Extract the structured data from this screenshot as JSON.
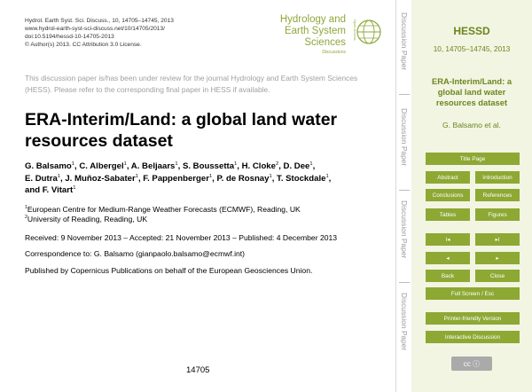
{
  "header": {
    "journal_line": "Hydrol. Earth Syst. Sci. Discuss., 10, 14705–14745, 2013",
    "url": "www.hydrol-earth-syst-sci-discuss.net/10/14705/2013/",
    "doi": "doi:10.5194/hessd-10-14705-2013",
    "license": "© Author(s) 2013. CC Attribution 3.0 License."
  },
  "logo": {
    "line1": "Hydrology and",
    "line2": "Earth System",
    "line3": "Sciences",
    "sub": "Discussions",
    "vertical": "Open Access"
  },
  "notice": "This discussion paper is/has been under review for the journal Hydrology and Earth System Sciences (HESS). Please refer to the corresponding final paper in HESS if available.",
  "title": "ERA-Interim/Land: a global land water resources dataset",
  "authors": {
    "a1": "G. Balsamo",
    "s1": "1",
    "a2": ", C. Albergel",
    "s2": "1",
    "a3": ", A. Beljaars",
    "s3": "1",
    "a4": ", S. Boussetta",
    "s4": "1",
    "a5": ", H. Cloke",
    "s5": "2",
    "a6": ", D. Dee",
    "s6": "1",
    "a7": ",",
    "b1": "E. Dutra",
    "t1": "1",
    "b2": ", J. Muñoz-Sabater",
    "t2": "1",
    "b3": ", F. Pappenberger",
    "t3": "1",
    "b4": ", P. de Rosnay",
    "t4": "1",
    "b5": ", T. Stockdale",
    "t5": "1",
    "b6": ",",
    "c1": "and F. Vitart",
    "u1": "1"
  },
  "affiliations": [
    {
      "sup": "1",
      "text": "European Centre for Medium-Range Weather Forecasts (ECMWF), Reading, UK"
    },
    {
      "sup": "2",
      "text": "University of Reading, Reading, UK"
    }
  ],
  "dates": "Received: 9 November 2013 – Accepted: 21 November 2013 – Published: 4 December 2013",
  "correspondence": "Correspondence to: G. Balsamo (gianpaolo.balsamo@ecmwf.int)",
  "published_by": "Published by Copernicus Publications on behalf of the European Geosciences Union.",
  "page_number": "14705",
  "strip": {
    "labels": [
      "Discussion Paper",
      "Discussion Paper",
      "Discussion Paper",
      "Discussion Paper"
    ],
    "separator": "|"
  },
  "sidebar": {
    "abbr": "HESSD",
    "volume": "10, 14705–14745, 2013",
    "title": "ERA-Interim/Land: a global land water resources dataset",
    "author": "G. Balsamo et al.",
    "buttons": {
      "title_page": "Title Page",
      "abstract": "Abstract",
      "introduction": "Introduction",
      "conclusions": "Conclusions",
      "references": "References",
      "tables": "Tables",
      "figures": "Figures",
      "first": "I◂",
      "last": "▸I",
      "prev": "◂",
      "next": "▸",
      "back": "Back",
      "close": "Close",
      "fullscreen": "Full Screen / Esc",
      "printer": "Printer-friendly Version",
      "interactive": "Interactive Discussion"
    },
    "cc_label": "cc ⓘ"
  },
  "colors": {
    "accent": "#8ea834",
    "sidebar_bg": "#f2f5e2",
    "sidebar_text": "#6c8520"
  }
}
